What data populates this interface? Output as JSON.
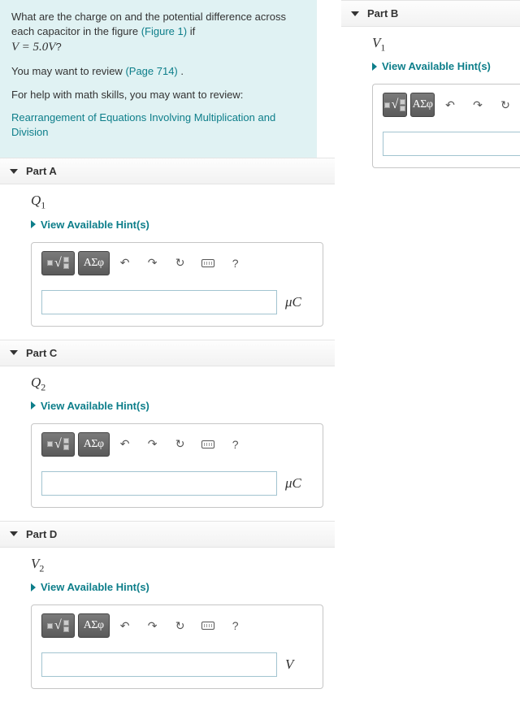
{
  "intro": {
    "line1a": "What are the charge on and the potential difference across each capacitor in the figure ",
    "figure_link": "(Figure 1)",
    "line1b": " if ",
    "equation": "V = 5.0V",
    "line1c": "?",
    "review_a": "You may want to review ",
    "review_link": "(Page 714)",
    "review_b": " .",
    "help_line": "For help with math skills, you may want to review:",
    "help_link": "Rearrangement of Equations Involving Multiplication and Division"
  },
  "hints_label": "View Available Hint(s)",
  "toolbar": {
    "greek": "ΑΣφ",
    "undo": "↶",
    "redo": "↷",
    "refresh": "↻",
    "keyboard": "kb",
    "help": "?"
  },
  "parts": {
    "a": {
      "title": "Part A",
      "var_label": "Q",
      "var_sub": "1",
      "unit": "μC"
    },
    "b": {
      "title": "Part B",
      "var_label": "V",
      "var_sub": "1",
      "unit": ""
    },
    "c": {
      "title": "Part C",
      "var_label": "Q",
      "var_sub": "2",
      "unit": "μC"
    },
    "d": {
      "title": "Part D",
      "var_label": "V",
      "var_sub": "2",
      "unit": "V"
    }
  }
}
